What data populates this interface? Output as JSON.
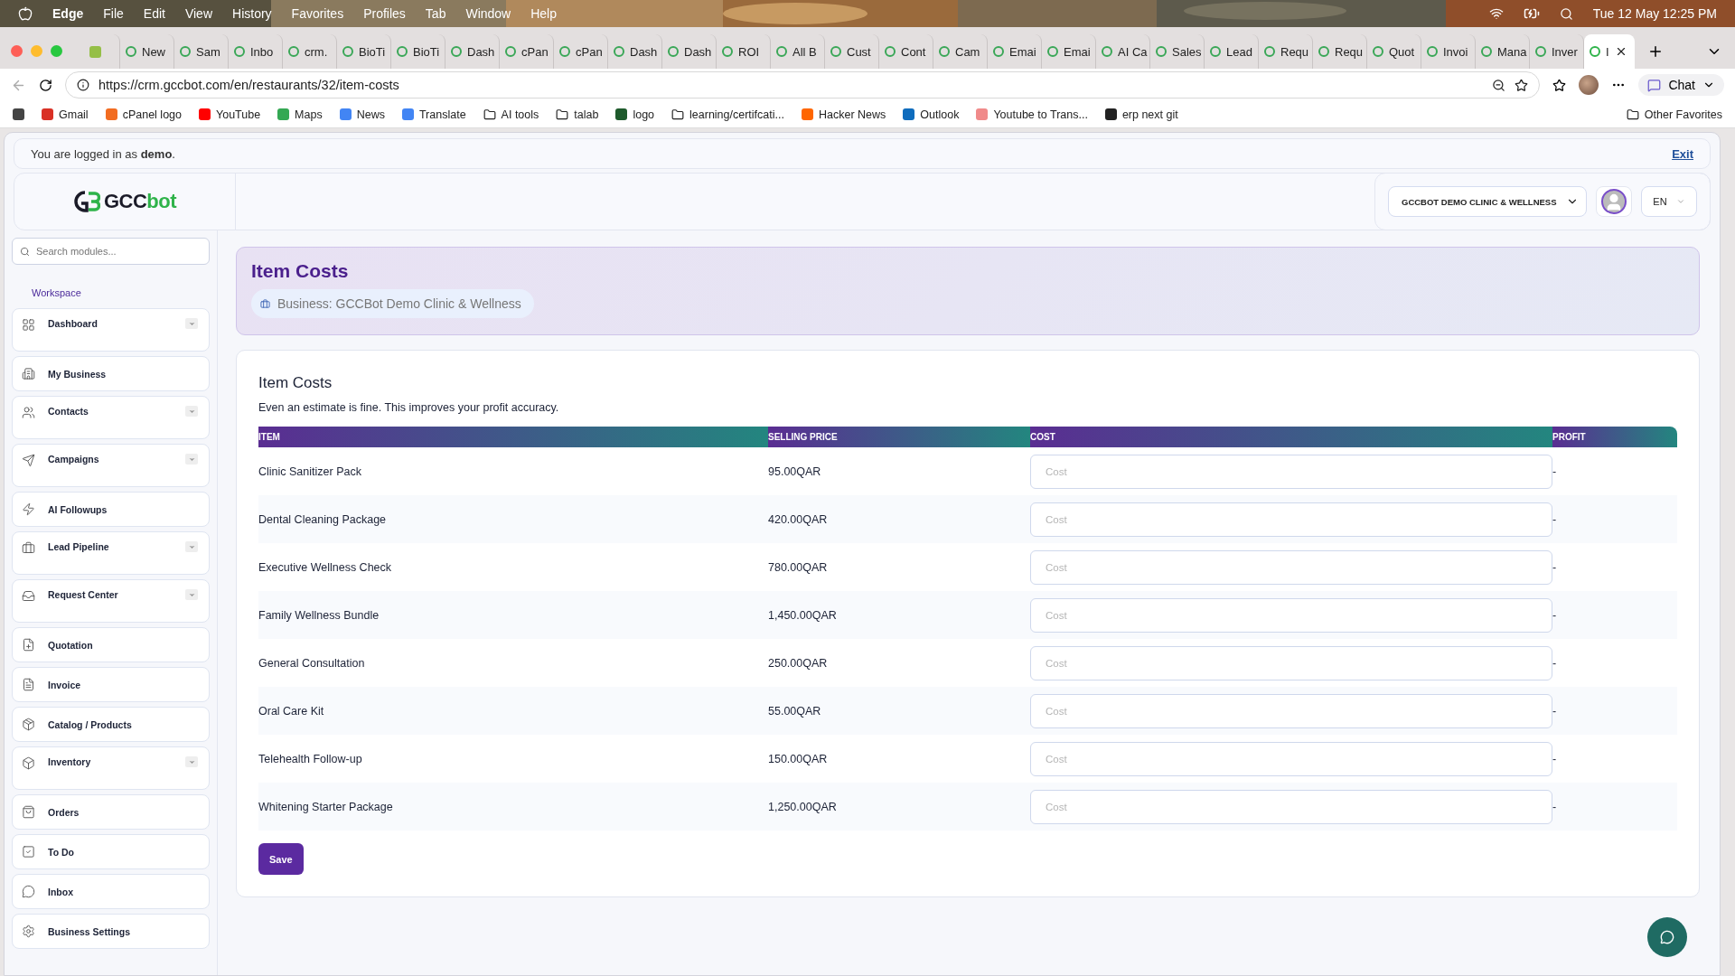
{
  "menubar": {
    "app": "Edge",
    "menus": [
      "File",
      "Edit",
      "View",
      "History",
      "Favorites",
      "Profiles",
      "Tab",
      "Window",
      "Help"
    ],
    "clock": "Tue 12 May  12:25 PM"
  },
  "browser": {
    "tabs": [
      {
        "label": "New",
        "selected": false
      },
      {
        "label": "Sam",
        "selected": false
      },
      {
        "label": "Inbo",
        "selected": false
      },
      {
        "label": "crm.",
        "selected": false
      },
      {
        "label": "BioTi",
        "selected": false
      },
      {
        "label": "BioTi",
        "selected": false
      },
      {
        "label": "Dash",
        "selected": false
      },
      {
        "label": "cPan",
        "selected": false
      },
      {
        "label": "cPan",
        "selected": false
      },
      {
        "label": "Dash",
        "selected": false
      },
      {
        "label": "Dash",
        "selected": false
      },
      {
        "label": "ROI",
        "selected": false
      },
      {
        "label": "All B",
        "selected": false
      },
      {
        "label": "Cust",
        "selected": false
      },
      {
        "label": "Cont",
        "selected": false
      },
      {
        "label": "Cam",
        "selected": false
      },
      {
        "label": "Emai",
        "selected": false
      },
      {
        "label": "Emai",
        "selected": false
      },
      {
        "label": "AI Ca",
        "selected": false
      },
      {
        "label": "Sales",
        "selected": false
      },
      {
        "label": "Lead",
        "selected": false
      },
      {
        "label": "Requ",
        "selected": false
      },
      {
        "label": "Requ",
        "selected": false
      },
      {
        "label": "Quot",
        "selected": false
      },
      {
        "label": "Invoi",
        "selected": false
      },
      {
        "label": "Mana",
        "selected": false
      },
      {
        "label": "Inver",
        "selected": false
      },
      {
        "label": "I",
        "selected": true
      }
    ],
    "url": "https://crm.gccbot.com/en/restaurants/32/item-costs",
    "chat": "Chat",
    "bookmarks": [
      {
        "label": "Gmail",
        "kind": "site"
      },
      {
        "label": "cPanel logo",
        "kind": "site"
      },
      {
        "label": "YouTube",
        "kind": "site"
      },
      {
        "label": "Maps",
        "kind": "site"
      },
      {
        "label": "News",
        "kind": "site"
      },
      {
        "label": "Translate",
        "kind": "site"
      },
      {
        "label": "AI tools",
        "kind": "folder"
      },
      {
        "label": "talab",
        "kind": "folder"
      },
      {
        "label": "logo",
        "kind": "site"
      },
      {
        "label": "learning/certifcati...",
        "kind": "folder"
      },
      {
        "label": "Hacker News",
        "kind": "site"
      },
      {
        "label": "Outlook",
        "kind": "site"
      },
      {
        "label": "Youtube to Trans...",
        "kind": "site"
      },
      {
        "label": "erp next git",
        "kind": "site"
      }
    ],
    "other_favorites": "Other Favorites"
  },
  "banner": {
    "text": "You are logged in as **demo**.",
    "exit": "Exit"
  },
  "header": {
    "logo": [
      "GCC",
      "bot"
    ],
    "business_select": "GCCBOT DEMO CLINIC & WELLNESS",
    "language": "EN"
  },
  "sidebar": {
    "search_placeholder": "Search modules...",
    "section": "Workspace",
    "items": [
      {
        "label": "Dashboard",
        "has_submenu": true
      },
      {
        "label": "My Business",
        "has_submenu": false
      },
      {
        "label": "Contacts",
        "has_submenu": true
      },
      {
        "label": "Campaigns",
        "has_submenu": true
      },
      {
        "label": "AI Followups",
        "has_submenu": false
      },
      {
        "label": "Lead Pipeline",
        "has_submenu": true
      },
      {
        "label": "Request Center",
        "has_submenu": true
      },
      {
        "label": "Quotation",
        "has_submenu": false
      },
      {
        "label": "Invoice",
        "has_submenu": false
      },
      {
        "label": "Catalog / Products",
        "has_submenu": false
      },
      {
        "label": "Inventory",
        "has_submenu": true
      },
      {
        "label": "Orders",
        "has_submenu": false
      },
      {
        "label": "To Do",
        "has_submenu": false
      },
      {
        "label": "Inbox",
        "has_submenu": false
      },
      {
        "label": "Business Settings",
        "has_submenu": false
      }
    ]
  },
  "page_header": {
    "title": "Item Costs",
    "business": "Business: GCCBot Demo Clinic & Wellness"
  },
  "card": {
    "title": "Item Costs",
    "subtitle": "Even an estimate is fine. This improves your profit accuracy.",
    "table": {
      "columns": [
        "ITEM",
        "SELLING PRICE",
        "COST",
        "PROFIT"
      ],
      "rows": [
        {
          "item": "Clinic Sanitizer Pack",
          "price": "95.00QAR",
          "cost_placeholder": "Cost",
          "profit": "-"
        },
        {
          "item": "Dental Cleaning Package",
          "price": "420.00QAR",
          "cost_placeholder": "Cost",
          "profit": "-"
        },
        {
          "item": "Executive Wellness Check",
          "price": "780.00QAR",
          "cost_placeholder": "Cost",
          "profit": "-"
        },
        {
          "item": "Family Wellness Bundle",
          "price": "1,450.00QAR",
          "cost_placeholder": "Cost",
          "profit": "-"
        },
        {
          "item": "General Consultation",
          "price": "250.00QAR",
          "cost_placeholder": "Cost",
          "profit": "-"
        },
        {
          "item": "Oral Care Kit",
          "price": "55.00QAR",
          "cost_placeholder": "Cost",
          "profit": "-"
        },
        {
          "item": "Telehealth Follow-up",
          "price": "150.00QAR",
          "cost_placeholder": "Cost",
          "profit": "-"
        },
        {
          "item": "Whitening Starter Package",
          "price": "1,250.00QAR",
          "cost_placeholder": "Cost",
          "profit": "-"
        }
      ]
    },
    "save": "Save"
  }
}
